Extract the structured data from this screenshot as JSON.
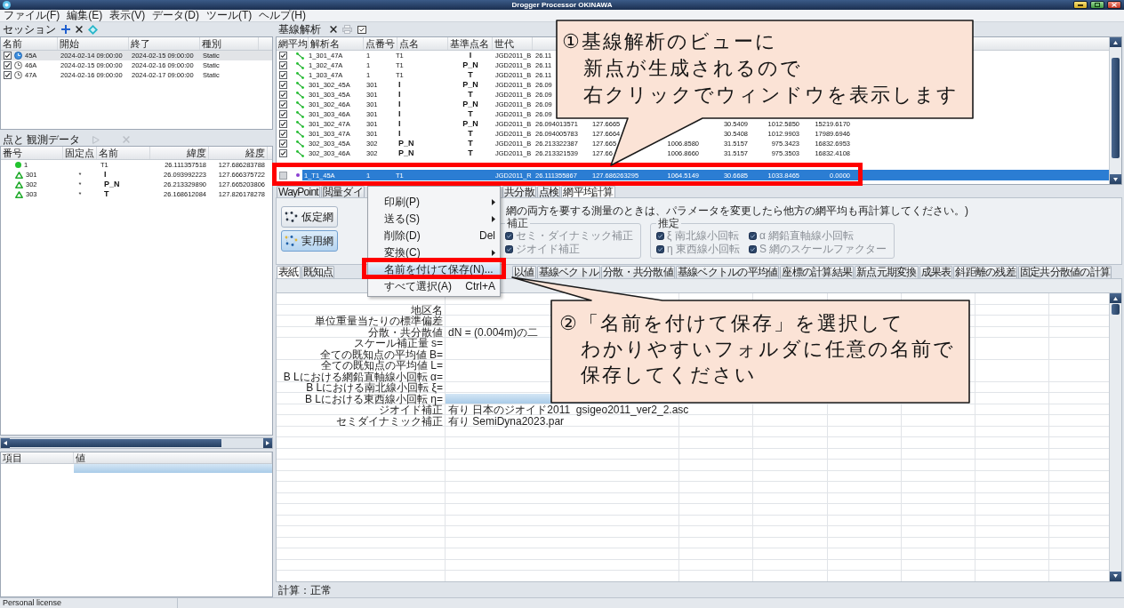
{
  "window": {
    "title": "Drogger Processor OKINAWA"
  },
  "menu": [
    "ファイル(F)",
    "編集(E)",
    "表示(V)",
    "データ(D)",
    "ツール(T)",
    "ヘルプ(H)"
  ],
  "session_panel": {
    "title": "セッション",
    "columns": [
      "名前",
      "開始",
      "終了",
      "種別"
    ],
    "rows": [
      {
        "checked": true,
        "selected": true,
        "name": "45A",
        "start": "2024-02-14 09:00:00",
        "end": "2024-02-15 09:00:00",
        "type": "Static"
      },
      {
        "checked": true,
        "selected": false,
        "name": "46A",
        "start": "2024-02-15 09:00:00",
        "end": "2024-02-16 09:00:00",
        "type": "Static"
      },
      {
        "checked": true,
        "selected": false,
        "name": "47A",
        "start": "2024-02-16 09:00:00",
        "end": "2024-02-17 09:00:00",
        "type": "Static"
      }
    ]
  },
  "point_panel": {
    "title": "点と 観測データ",
    "columns": [
      "番号",
      "固定点",
      "名前",
      "緯度",
      "経度"
    ],
    "rows": [
      {
        "kind": "known",
        "number": "1",
        "name": "T1",
        "latitude": "26.111357518",
        "longitude": "127.686283788"
      },
      {
        "kind": "new",
        "number": "301",
        "fixed": "*",
        "name": "I",
        "latitude": "26.093992223",
        "longitude": "127.666375722"
      },
      {
        "kind": "new",
        "number": "302",
        "fixed": "*",
        "name": "P_N",
        "latitude": "26.213329890",
        "longitude": "127.665203806"
      },
      {
        "kind": "new",
        "number": "303",
        "fixed": "*",
        "name": "T",
        "latitude": "26.168612084",
        "longitude": "127.826178278"
      }
    ]
  },
  "property_panel": {
    "columns": [
      "項目",
      "値"
    ],
    "rows": [
      {
        "selected": true
      }
    ]
  },
  "baseline_panel": {
    "title": "基線解析",
    "columns": [
      "網平均",
      "解析名",
      "点番号",
      "点名",
      "基準点名",
      "世代"
    ],
    "rows": [
      {
        "kind": "baseline",
        "checked": true,
        "selected": false,
        "name": "1_301_47A",
        "point_number": "1",
        "point": {
          "text": "T1",
          "bold": false
        },
        "reference": "I",
        "datum": "JGD2011_B",
        "column_7": "26.11"
      },
      {
        "kind": "baseline",
        "checked": true,
        "selected": false,
        "name": "1_302_47A",
        "point_number": "1",
        "point": {
          "text": "T1",
          "bold": false
        },
        "reference": "P_N",
        "datum": "JGD2011_B",
        "column_7": "26.11"
      },
      {
        "kind": "baseline",
        "checked": true,
        "selected": false,
        "name": "1_303_47A",
        "point_number": "1",
        "point": {
          "text": "T1",
          "bold": false
        },
        "reference": "T",
        "datum": "JGD2011_B",
        "column_7": "26.11"
      },
      {
        "kind": "baseline",
        "checked": true,
        "selected": false,
        "name": "301_302_45A",
        "point_number": "301",
        "point": {
          "text": "I",
          "bold": true
        },
        "reference": "P_N",
        "datum": "JGD2011_B",
        "column_7": "26.09"
      },
      {
        "kind": "baseline",
        "checked": true,
        "selected": false,
        "name": "301_303_45A",
        "point_number": "301",
        "point": {
          "text": "I",
          "bold": true
        },
        "reference": "T",
        "datum": "JGD2011_B",
        "column_7": "26.09"
      },
      {
        "kind": "baseline",
        "checked": true,
        "selected": false,
        "name": "301_302_46A",
        "point_number": "301",
        "point": {
          "text": "I",
          "bold": true
        },
        "reference": "P_N",
        "datum": "JGD2011_B",
        "column_7": "26.09"
      },
      {
        "kind": "baseline",
        "checked": true,
        "selected": false,
        "name": "301_303_46A",
        "point_number": "301",
        "point": {
          "text": "I",
          "bold": true
        },
        "reference": "T",
        "datum": "JGD2011_B",
        "column_7": "26.09"
      },
      {
        "kind": "baseline",
        "checked": true,
        "selected": false,
        "name": "301_302_47A",
        "point_number": "301",
        "point": {
          "text": "I",
          "bold": true
        },
        "reference": "P_N",
        "datum": "JGD2011_B",
        "column_7": "26.094013571",
        "column_8": "127.6665",
        "column_10": "30.5409",
        "column_11": "1012.5850",
        "column_12": "15219.6170"
      },
      {
        "kind": "baseline",
        "checked": true,
        "selected": false,
        "name": "301_303_47A",
        "point_number": "301",
        "point": {
          "text": "I",
          "bold": true
        },
        "reference": "T",
        "datum": "JGD2011_B",
        "column_7": "26.094005783",
        "column_8": "127.6664",
        "column_10": "30.5408",
        "column_11": "1012.9903",
        "column_12": "17989.6946"
      },
      {
        "kind": "baseline",
        "checked": true,
        "selected": false,
        "name": "302_303_45A",
        "point_number": "302",
        "point": {
          "text": "P_N",
          "bold": true
        },
        "reference": "T",
        "datum": "JGD2011_B",
        "column_7": "26.213322387",
        "column_8": "127.665",
        "column_9": "1006.8580",
        "column_10": "31.5157",
        "column_11": "975.3423",
        "column_12": "16832.6953"
      },
      {
        "kind": "baseline",
        "checked": true,
        "selected": false,
        "name": "302_303_46A",
        "point_number": "302",
        "point": {
          "text": "P_N",
          "bold": true
        },
        "reference": "T",
        "datum": "JGD2011_B",
        "column_7": "26.213321539",
        "column_8": "127.66",
        "column_9": "1006.8660",
        "column_10": "31.5157",
        "column_11": "975.3503",
        "column_12": "16832.4108"
      },
      {
        "kind": "point",
        "checked": false,
        "selected": true,
        "name": "1_T1_45A",
        "point_number": "1",
        "point": {
          "text": "T1",
          "bold": false
        },
        "datum": "JGD2011_R",
        "column_7": "26.111355867",
        "column_8": "127.686263295",
        "column_9": "1064.5149",
        "column_10": "30.6685",
        "column_11": "1033.8465",
        "column_12": "0.0000"
      }
    ]
  },
  "view_tabs": [
    {
      "label": "WayPoint",
      "selected": false
    },
    {
      "label": "閲量ダイ",
      "selected": false
    },
    {
      "label": "共分散",
      "selected": false
    },
    {
      "label": "点検",
      "selected": false
    },
    {
      "label": "網平均計算",
      "selected": true
    }
  ],
  "network_panel": {
    "buttons": [
      {
        "label": "仮定網",
        "selected": false
      },
      {
        "label": "実用網",
        "selected": true
      }
    ],
    "note": "網の両方を要する測量のときは、パラメータを変更したら他方の網平均も再計算してください。)",
    "groups": [
      {
        "title": "補正",
        "options": [
          {
            "label": "セミ・ダイナミック補正",
            "checked": true,
            "disabled": true
          },
          {
            "label": "ジオイド補正",
            "checked": true,
            "disabled": true
          }
        ]
      },
      {
        "title": "推定",
        "options": [
          {
            "label": "ξ 南北線小回転",
            "checked": true,
            "disabled": true
          },
          {
            "label": "α 網鉛直軸線小回転",
            "checked": true,
            "disabled": true
          },
          {
            "label": "η 東西線小回転",
            "checked": true,
            "disabled": true
          },
          {
            "label": "S 網のスケールファクター",
            "checked": true,
            "disabled": true
          }
        ]
      }
    ]
  },
  "result_tabs": [
    {
      "label": "表紙",
      "selected": true
    },
    {
      "label": "既知点",
      "selected": false
    },
    {
      "label": "以値",
      "selected": false
    },
    {
      "label": "基線ベクトル",
      "selected": false
    },
    {
      "label": "分散・共分散値",
      "selected": false
    },
    {
      "label": "基線ベクトルの平均値",
      "selected": false
    },
    {
      "label": "座標の計算結果",
      "selected": false
    },
    {
      "label": "新点元期変換",
      "selected": false
    },
    {
      "label": "成果表",
      "selected": false
    },
    {
      "label": "斜距離の残差",
      "selected": false
    },
    {
      "label": "固定共分散値の計算",
      "selected": false
    }
  ],
  "report": {
    "rows": [
      {
        "label": "地区名",
        "selected": false
      },
      {
        "label": "単位重量当たりの標準偏差",
        "selected": false
      },
      {
        "label": "分散・共分散値",
        "value": "dN = (0.004m)の二",
        "selected": false
      },
      {
        "label": "スケール補正量 s=",
        "selected": false
      },
      {
        "label": "全ての既知点の平均値 B=",
        "selected": false
      },
      {
        "label": "全ての既知点の平均値 L=",
        "selected": false
      },
      {
        "label": "B Lにおける網鉛直軸線小回転 α=",
        "selected": false
      },
      {
        "label": "B Lにおける南北線小回転 ξ=",
        "selected": false
      },
      {
        "label": "B Lにおける東西線小回転 η=",
        "selected": true
      },
      {
        "label": "ジオイド補正",
        "value": "有り 日本のジオイド2011  gsigeo2011_ver2_2.asc",
        "selected": false
      },
      {
        "label": "セミダイナミック補正",
        "value": "有り SemiDyna2023.par",
        "selected": false
      }
    ]
  },
  "calc_status": "計算：正常",
  "context_menu": {
    "items": [
      {
        "label": "印刷(P)",
        "submenu": true,
        "selected": false
      },
      {
        "label": "送る(S)",
        "submenu": true,
        "selected": false
      },
      {
        "label": "削除(D)",
        "shortcut": "Del",
        "selected": false
      },
      {
        "label": "変換(C)",
        "submenu": true,
        "selected": false
      },
      {
        "label": "名前を付けて保存(N)...",
        "selected": true
      },
      {
        "label": "すべて選択(A)",
        "shortcut": "Ctrl+A",
        "selected": false
      }
    ]
  },
  "callouts": [
    {
      "lines": [
        "①基線解析のビューに",
        "新点が生成されるので",
        "右クリックでウィンドウを表示します"
      ]
    },
    {
      "lines": [
        "②「名前を付けて保存」を選択して",
        "わかりやすいフォルダに任意の名前で",
        "保存してください"
      ]
    }
  ],
  "status_bar": {
    "license": "Personal license"
  }
}
